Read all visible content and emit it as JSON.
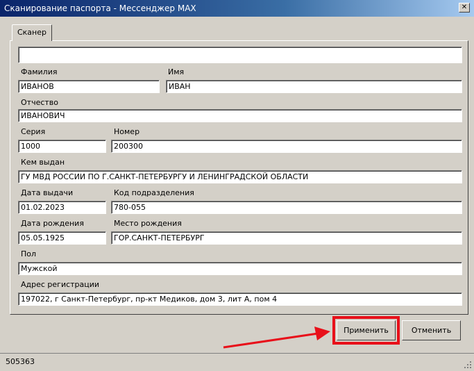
{
  "window": {
    "title": "Сканирование паспорта - Мессенджер MAX",
    "close_symbol": "✕"
  },
  "tabs": [
    {
      "label": "Сканер"
    }
  ],
  "form": {
    "scan_input": {
      "value": ""
    },
    "surname": {
      "label": "Фамилия",
      "value": "ИВАНОВ"
    },
    "name": {
      "label": "Имя",
      "value": "ИВАН"
    },
    "patronymic": {
      "label": "Отчество",
      "value": "ИВАНОВИЧ"
    },
    "series": {
      "label": "Серия",
      "value": "1000"
    },
    "number": {
      "label": "Номер",
      "value": "200300"
    },
    "issued_by": {
      "label": "Кем выдан",
      "value": "ГУ МВД РОССИИ ПО Г.САНКТ-ПЕТЕРБУРГУ И ЛЕНИНГРАДСКОЙ ОБЛАСТИ"
    },
    "issue_date": {
      "label": "Дата выдачи",
      "value": "01.02.2023"
    },
    "department_code": {
      "label": "Код подразделения",
      "value": "780-055"
    },
    "birth_date": {
      "label": "Дата рождения",
      "value": "05.05.1925"
    },
    "birth_place": {
      "label": "Место рождения",
      "value": "ГОР.САНКТ-ПЕТЕРБУРГ"
    },
    "sex": {
      "label": "Пол",
      "value": "Мужской"
    },
    "address": {
      "label": "Адрес регистрации",
      "value": "197022, г Санкт-Петербург, пр-кт Медиков, дом 3, лит А, пом 4"
    }
  },
  "buttons": {
    "apply": "Применить",
    "cancel": "Отменить"
  },
  "status": {
    "text": "505363"
  },
  "annotation": {
    "arrow_color": "#e8101a",
    "highlight_color": "#e8101a"
  }
}
